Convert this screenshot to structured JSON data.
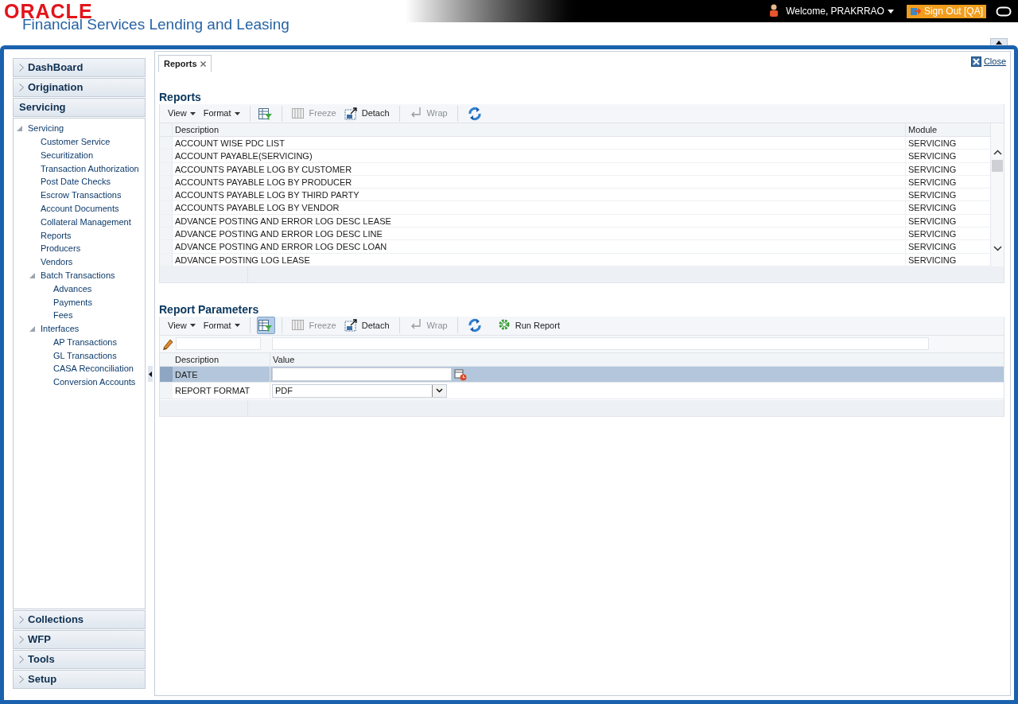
{
  "header": {
    "brand": "ORACLE",
    "app_title": "Financial Services Lending and Leasing",
    "welcome": "Welcome, PRAKRRAO",
    "sign_out": "Sign Out [QA]"
  },
  "sidebar": {
    "sections": [
      {
        "label": "DashBoard",
        "expanded": false
      },
      {
        "label": "Origination",
        "expanded": false
      },
      {
        "label": "Servicing",
        "expanded": true,
        "tree": [
          {
            "label": "Servicing",
            "expanded": true,
            "children": [
              {
                "label": "Customer Service"
              },
              {
                "label": "Securitization"
              },
              {
                "label": "Transaction Authorization"
              },
              {
                "label": "Post Date Checks"
              },
              {
                "label": "Escrow Transactions"
              },
              {
                "label": "Account Documents"
              },
              {
                "label": "Collateral Management"
              },
              {
                "label": "Reports"
              },
              {
                "label": "Producers"
              },
              {
                "label": "Vendors"
              },
              {
                "label": "Batch Transactions",
                "expanded": true,
                "children": [
                  {
                    "label": "Advances"
                  },
                  {
                    "label": "Payments"
                  },
                  {
                    "label": "Fees"
                  }
                ]
              },
              {
                "label": "Interfaces",
                "expanded": true,
                "children": [
                  {
                    "label": "AP Transactions"
                  },
                  {
                    "label": "GL Transactions"
                  },
                  {
                    "label": "CASA Reconciliation"
                  },
                  {
                    "label": "Conversion Accounts"
                  }
                ]
              }
            ]
          }
        ]
      },
      {
        "label": "Collections",
        "expanded": false
      },
      {
        "label": "WFP",
        "expanded": false
      },
      {
        "label": "Tools",
        "expanded": false
      },
      {
        "label": "Setup",
        "expanded": false
      }
    ]
  },
  "tabs": [
    {
      "label": "Reports",
      "selected": true
    }
  ],
  "close": "Close",
  "reports": {
    "title": "Reports",
    "toolbar": [
      {
        "kind": "menu",
        "label": "View"
      },
      {
        "kind": "menu",
        "label": "Format"
      },
      {
        "kind": "filter",
        "on": false
      },
      {
        "kind": "freeze",
        "label": "Freeze",
        "disabled": true
      },
      {
        "kind": "detach",
        "label": "Detach",
        "disabled": false
      },
      {
        "kind": "wrap",
        "label": "Wrap",
        "disabled": true
      },
      {
        "kind": "refresh"
      }
    ],
    "columns": [
      "Description",
      "Module"
    ],
    "rows": [
      {
        "description": "ACCOUNT WISE PDC LIST",
        "module": "SERVICING"
      },
      {
        "description": "ACCOUNT PAYABLE(SERVICING)",
        "module": "SERVICING"
      },
      {
        "description": "ACCOUNTS PAYABLE LOG BY CUSTOMER",
        "module": "SERVICING"
      },
      {
        "description": "ACCOUNTS PAYABLE LOG BY PRODUCER",
        "module": "SERVICING"
      },
      {
        "description": "ACCOUNTS PAYABLE LOG BY THIRD PARTY",
        "module": "SERVICING"
      },
      {
        "description": "ACCOUNTS PAYABLE LOG BY VENDOR",
        "module": "SERVICING"
      },
      {
        "description": "ADVANCE POSTING AND ERROR LOG DESC LEASE",
        "module": "SERVICING"
      },
      {
        "description": "ADVANCE POSTING AND ERROR LOG DESC LINE",
        "module": "SERVICING"
      },
      {
        "description": "ADVANCE POSTING AND ERROR LOG DESC LOAN",
        "module": "SERVICING"
      },
      {
        "description": "ADVANCE POSTING LOG LEASE",
        "module": "SERVICING"
      }
    ]
  },
  "parameters": {
    "title": "Report Parameters",
    "toolbar": [
      {
        "kind": "menu",
        "label": "View"
      },
      {
        "kind": "menu",
        "label": "Format"
      },
      {
        "kind": "filter",
        "on": true
      },
      {
        "kind": "freeze",
        "label": "Freeze",
        "disabled": true
      },
      {
        "kind": "detach",
        "label": "Detach",
        "disabled": false
      },
      {
        "kind": "wrap",
        "label": "Wrap",
        "disabled": true
      },
      {
        "kind": "refresh"
      },
      {
        "kind": "run",
        "label": "Run Report"
      }
    ],
    "columns": [
      "Description",
      "Value"
    ],
    "rows": [
      {
        "description": "DATE",
        "kind": "date",
        "selected": true
      },
      {
        "description": "REPORT FORMAT",
        "kind": "select",
        "value": "PDF",
        "selected": false
      }
    ]
  }
}
